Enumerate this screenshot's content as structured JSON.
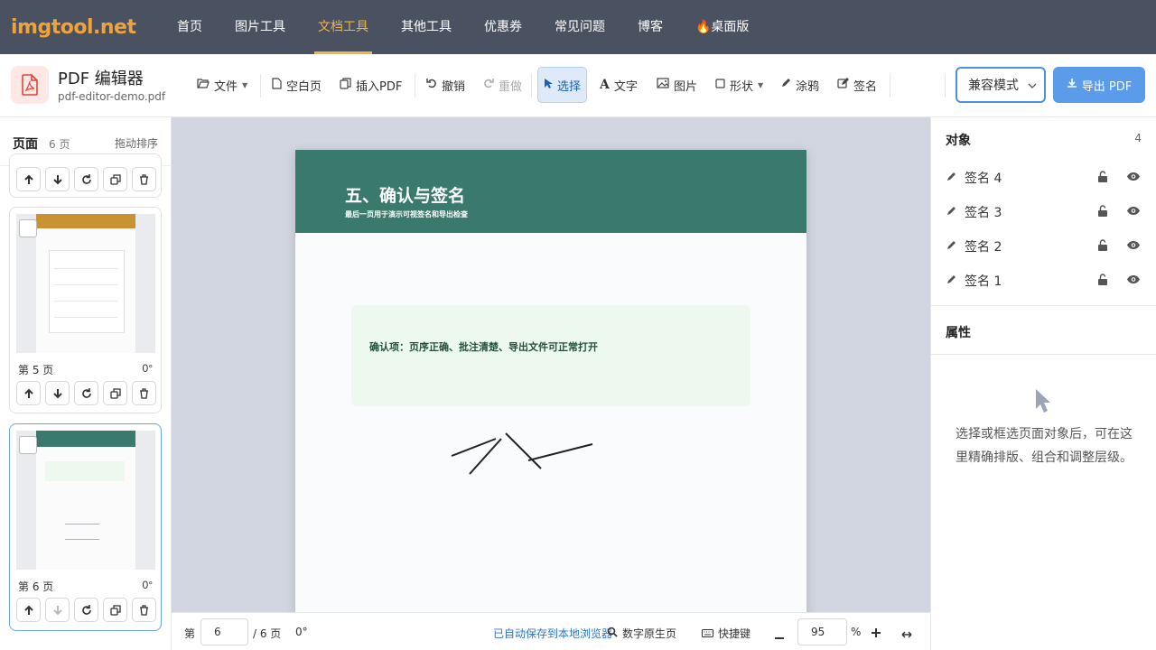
{
  "nav": {
    "logo": "imgtool.net",
    "items": [
      "首页",
      "图片工具",
      "文档工具",
      "其他工具",
      "优惠券",
      "常见问题",
      "博客",
      "🔥桌面版"
    ],
    "active_index": 2
  },
  "app": {
    "title": "PDF 编辑器",
    "filename": "pdf-editor-demo.pdf"
  },
  "toolbar": {
    "file": "文件",
    "blank_page": "空白页",
    "insert_pdf": "插入PDF",
    "undo": "撤销",
    "redo": "重做",
    "select": "选择",
    "text": "文字",
    "image": "图片",
    "shape": "形状",
    "draw": "涂鸦",
    "sign": "签名",
    "mode": "兼容模式",
    "export": "导出 PDF"
  },
  "pages_panel": {
    "title": "页面",
    "count": "6 页",
    "sort_hint": "拖动排序",
    "cards": [
      {
        "label": "第 5 页",
        "rotation": "0°"
      },
      {
        "label": "第 6 页",
        "rotation": "0°"
      }
    ]
  },
  "page": {
    "title": "五、确认与签名",
    "subtitle": "最后一页用于演示可视签名和导出检查",
    "confirm": "确认项：页序正确、批注清楚、导出文件可正常打开"
  },
  "status": {
    "page_prefix": "第",
    "page_value": "6",
    "page_total": "/ 6 页",
    "rotation": "0°",
    "autosave": "已自动保存到本地浏览器",
    "native_page": "数字原生页",
    "shortcuts": "快捷键",
    "zoom": "95",
    "zoom_unit": "%"
  },
  "objects_panel": {
    "title": "对象",
    "count": "4",
    "items": [
      "签名 4",
      "签名 3",
      "签名 2",
      "签名 1"
    ]
  },
  "props_panel": {
    "title": "属性",
    "hint": "选择或框选页面对象后，可在这里精确排版、组合和调整层级。"
  },
  "colors": {
    "nav_bg": "#4a5160",
    "accent": "#f0b545",
    "page_header": "#3a7a6c",
    "primary": "#5a9bea"
  }
}
